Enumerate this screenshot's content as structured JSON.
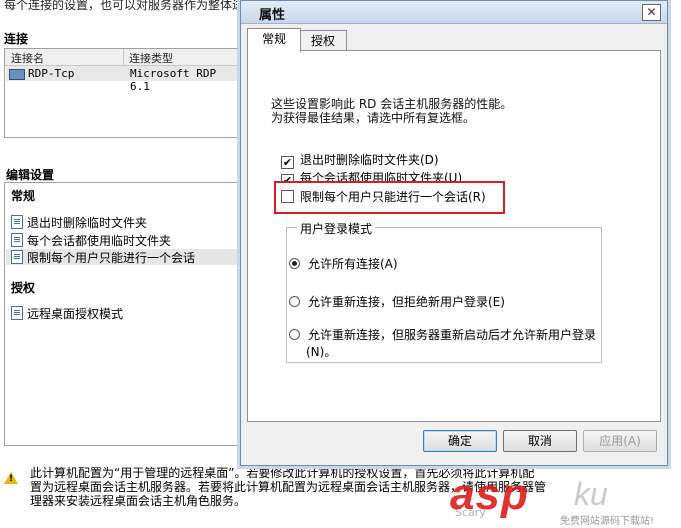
{
  "background": {
    "top_text": "每个连接的设置，也可以对服务器作为整体进",
    "connections": {
      "title": "连接",
      "col_name": "连接名",
      "col_type": "连接类型",
      "row_name": "RDP-Tcp",
      "row_type": "Microsoft RDP 6.1"
    },
    "edit_settings": {
      "title": "编辑设置",
      "general_header": "常规",
      "items": [
        "退出时删除临时文件夹",
        "每个会话都使用临时文件夹",
        "限制每个用户只能进行一个会话"
      ],
      "license_header": "授权",
      "license_items": [
        "远程桌面授权模式"
      ]
    },
    "warning_lines": [
      "此计算机配置为“用于管理的远程桌面”。若要修改此计算机的授权设置，首先必须将此计算机配",
      "置为远程桌面会话主机服务器。若要将此计算机配置为远程桌面会话主机服务器，请使用服务器管",
      "理器来安装远程桌面会话主机角色服务。"
    ]
  },
  "dialog": {
    "title": "属性",
    "close_glyph": "✕",
    "tabs": [
      "常规",
      "授权"
    ],
    "intro_line1": "这些设置影响此 RD 会话主机服务器的性能。",
    "intro_line2": "为获得最佳结果，请选中所有复选框。",
    "checkboxes": [
      {
        "label": "退出时删除临时文件夹(D)",
        "checked": "✔"
      },
      {
        "label": "每个会话都使用临时文件夹(U)",
        "checked": "✔"
      },
      {
        "label": "限制每个用户只能进行一个会话(R)",
        "checked": ""
      }
    ],
    "group_title": "用户登录模式",
    "radios": [
      {
        "label": "允许所有连接(A)",
        "selected": true
      },
      {
        "label": "允许重新连接，但拒绝新用户登录(E)",
        "selected": false
      },
      {
        "label_line1": "允许重新连接，但服务器重新启动后才允许新用户登录",
        "label_line2": "(N)。",
        "selected": false
      }
    ],
    "buttons": {
      "ok": "确定",
      "cancel": "取消",
      "apply": "应用(A)"
    }
  },
  "watermark": {
    "brand": "asp",
    "brand2": "ku",
    "small": "Scary",
    "sub": "免费网站源码下载站!"
  },
  "colors": {
    "highlight": "#d32020",
    "brand": "#e01a1a"
  }
}
